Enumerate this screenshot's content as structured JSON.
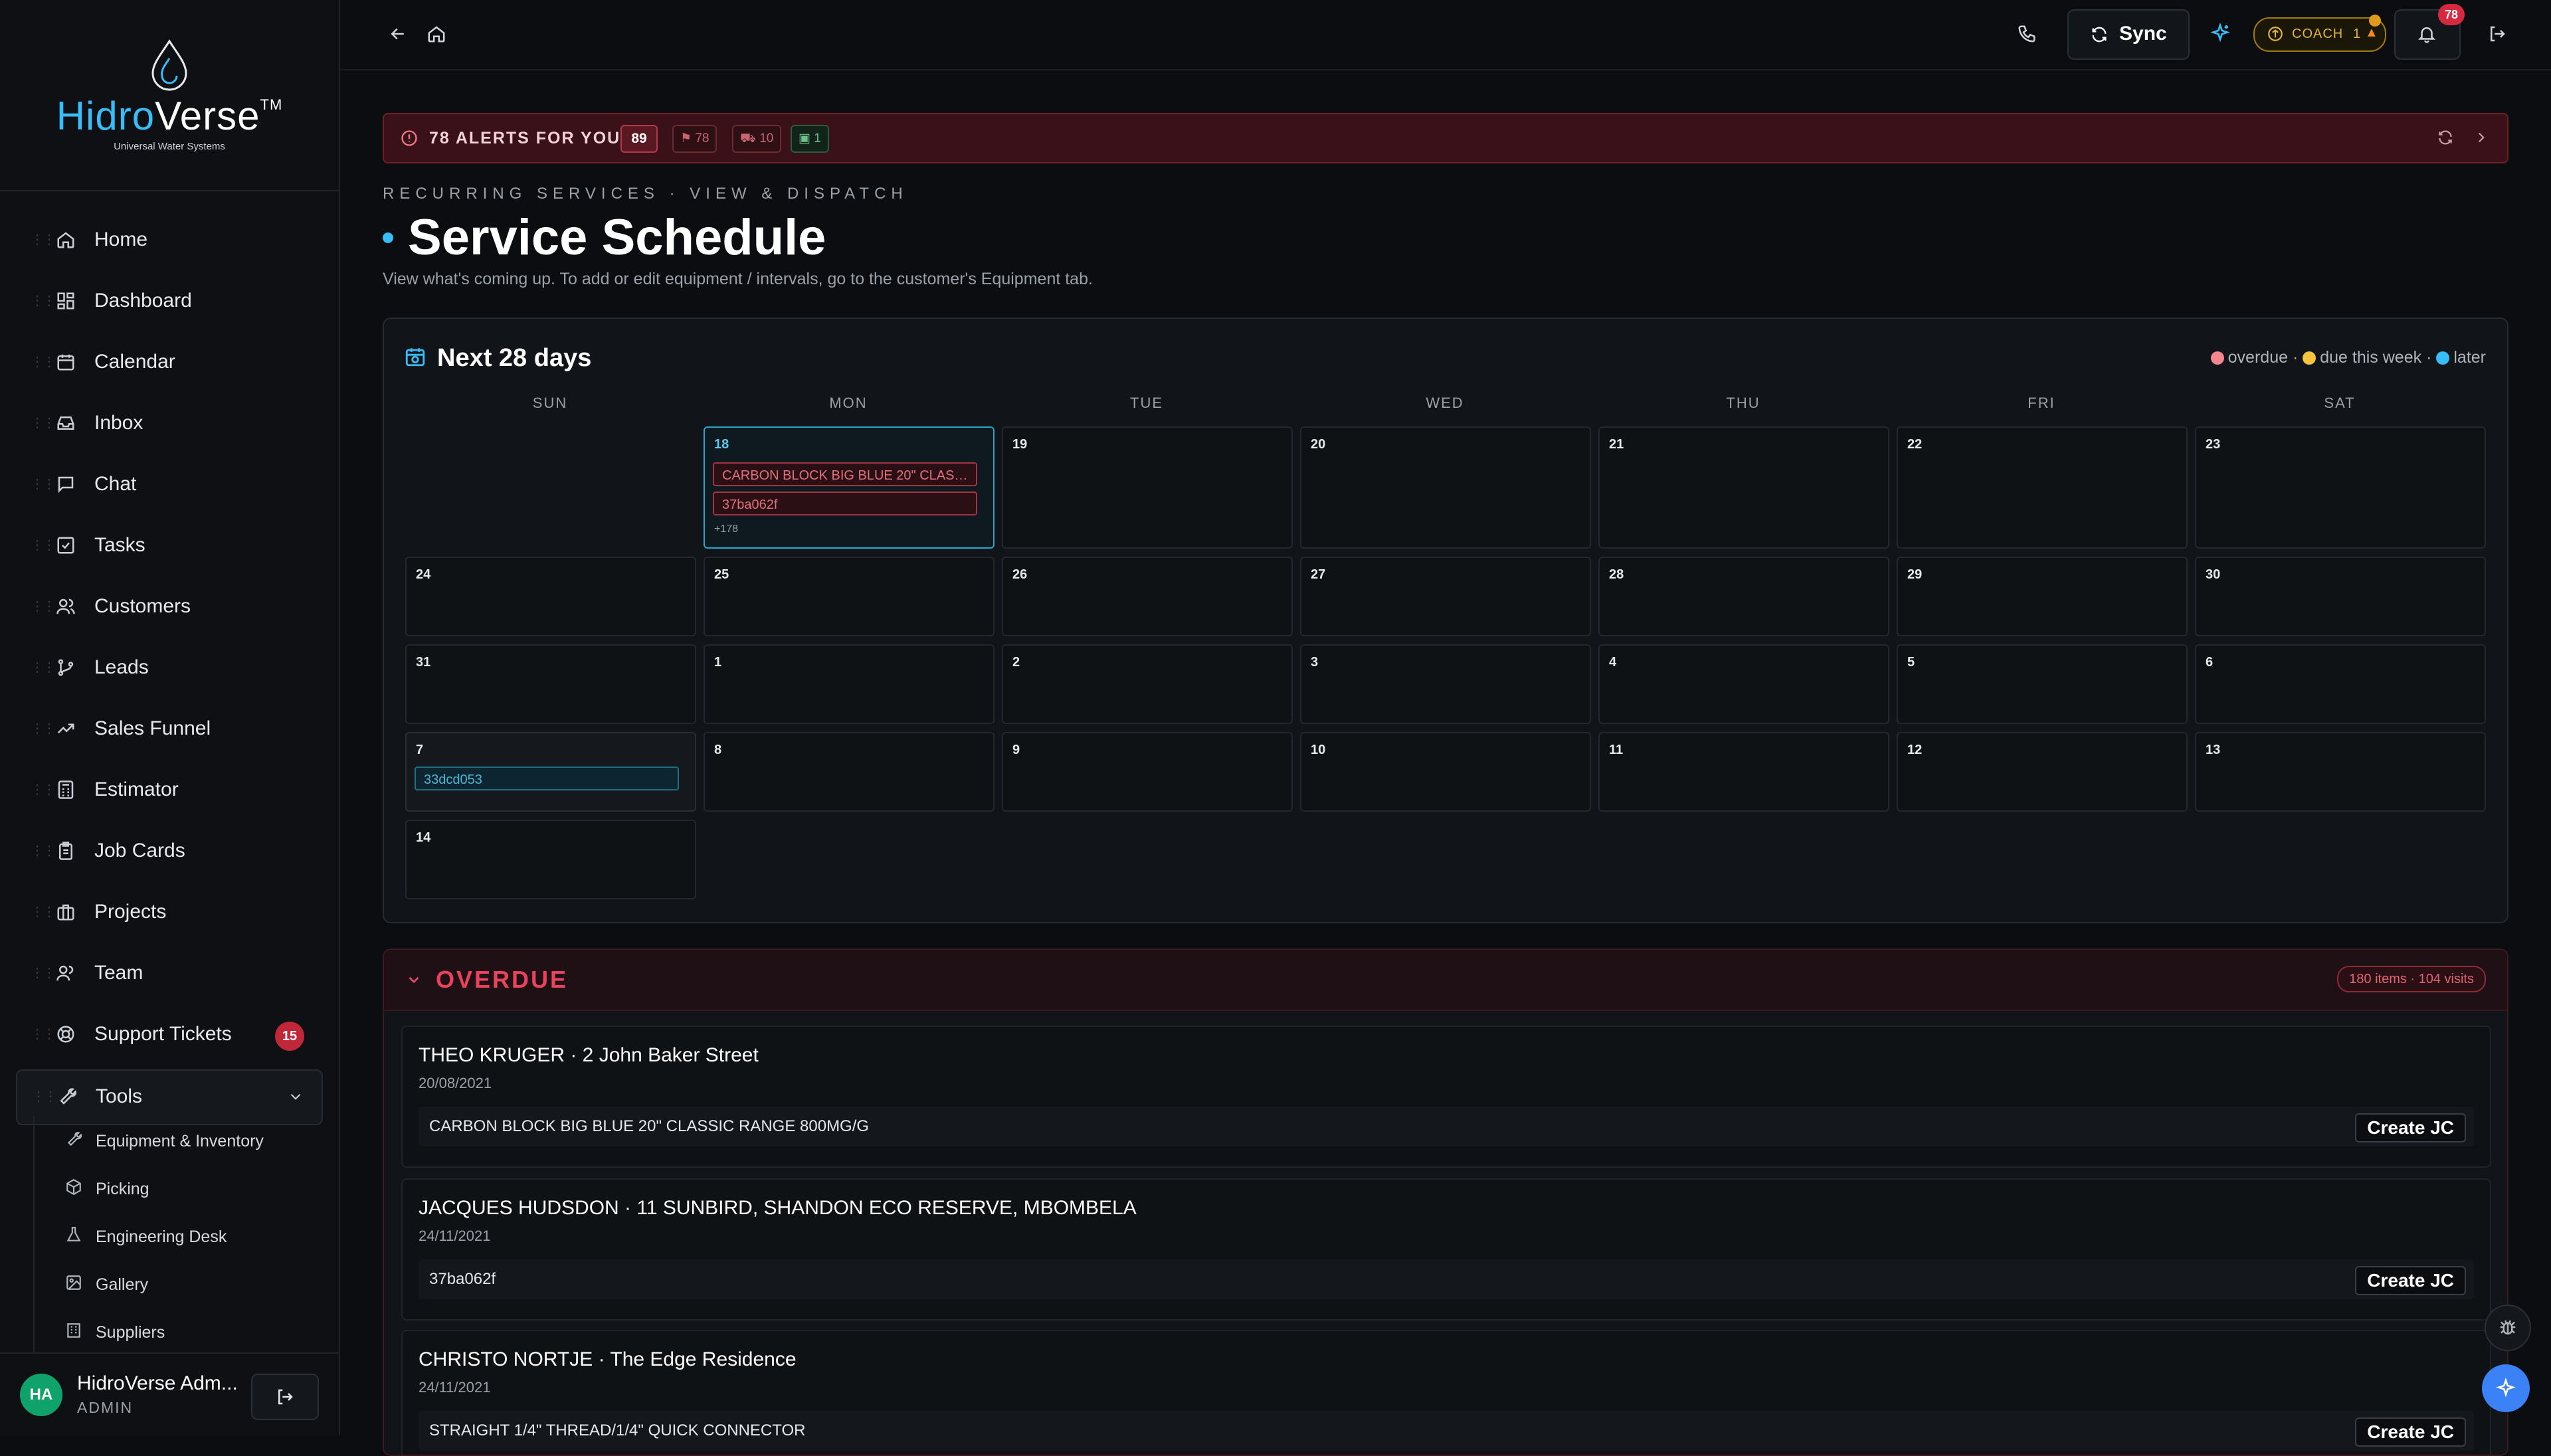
{
  "brand": {
    "name_part1": "Hidro",
    "name_part2": "Verse",
    "trademark": "TM",
    "tagline": "Universal Water Systems"
  },
  "sidebar": {
    "items": [
      {
        "label": "Home",
        "icon": "home-icon"
      },
      {
        "label": "Dashboard",
        "icon": "dashboard-icon"
      },
      {
        "label": "Calendar",
        "icon": "calendar-icon"
      },
      {
        "label": "Inbox",
        "icon": "inbox-icon"
      },
      {
        "label": "Chat",
        "icon": "chat-icon"
      },
      {
        "label": "Tasks",
        "icon": "tasks-icon"
      },
      {
        "label": "Customers",
        "icon": "customers-icon"
      },
      {
        "label": "Leads",
        "icon": "leads-icon"
      },
      {
        "label": "Sales Funnel",
        "icon": "trend-icon"
      },
      {
        "label": "Estimator",
        "icon": "calculator-icon"
      },
      {
        "label": "Job Cards",
        "icon": "clipboard-icon"
      },
      {
        "label": "Projects",
        "icon": "briefcase-icon"
      },
      {
        "label": "Team",
        "icon": "team-icon"
      },
      {
        "label": "Support Tickets",
        "icon": "lifebuoy-icon",
        "badge": "15"
      }
    ],
    "tools": {
      "label": "Tools",
      "icon": "wrench-icon"
    },
    "tools_sub": [
      {
        "label": "Equipment & Inventory",
        "icon": "wrench-icon"
      },
      {
        "label": "Picking",
        "icon": "package-icon"
      },
      {
        "label": "Engineering Desk",
        "icon": "flask-icon"
      },
      {
        "label": "Gallery",
        "icon": "image-icon"
      },
      {
        "label": "Suppliers",
        "icon": "building-icon"
      }
    ],
    "user": {
      "initials": "HA",
      "name": "HidroVerse Adm...",
      "role": "ADMIN"
    }
  },
  "topbar": {
    "sync_label": "Sync",
    "coach_label": "COACH",
    "coach_count": "1",
    "notification_count": "78"
  },
  "alerts": {
    "text": "78 ALERTS FOR YOU",
    "count": "89",
    "pills": {
      "flag": "78",
      "cart": "10",
      "box": "1"
    }
  },
  "page": {
    "kicker": "RECURRING SERVICES · VIEW & DISPATCH",
    "title": "Service Schedule",
    "subtitle": "View what's coming up. To add or edit equipment / intervals, go to the customer's Equipment tab."
  },
  "calendar": {
    "title": "Next 28 days",
    "legend": {
      "overdue": "overdue",
      "due_this_week": "due this week",
      "later": "later",
      "sep": "·"
    },
    "colors": {
      "overdue": "#f5868f",
      "due_this_week": "#f5c542",
      "later": "#38bdf8"
    },
    "weekdays": [
      "SUN",
      "MON",
      "TUE",
      "WED",
      "THU",
      "FRI",
      "SAT"
    ],
    "week1": [
      "18",
      "19",
      "20",
      "21",
      "22",
      "23"
    ],
    "week2": [
      "24",
      "25",
      "26",
      "27",
      "28",
      "29",
      "30"
    ],
    "week3": [
      "31",
      "1",
      "2",
      "3",
      "4",
      "5",
      "6"
    ],
    "week4": [
      "7",
      "8",
      "9",
      "10",
      "11",
      "12",
      "13"
    ],
    "week5": [
      "14"
    ],
    "today_events": [
      "CARBON BLOCK BIG BLUE 20\" CLASSIC RANGE 800MG/G",
      "37ba062f"
    ],
    "today_more": "+178",
    "day7_event": "33dcd053"
  },
  "overdue": {
    "title": "OVERDUE",
    "count": "180 items · 104 visits",
    "items": [
      {
        "name": "THEO KRUGER · 2 John Baker Street",
        "date": "20/08/2021",
        "line": "CARBON BLOCK BIG BLUE 20\" CLASSIC RANGE 800MG/G",
        "action": "Create JC"
      },
      {
        "name": "JACQUES HUDSDON · 11 SUNBIRD, SHANDON ECO RESERVE, MBOMBELA",
        "date": "24/11/2021",
        "line": "37ba062f",
        "action": "Create JC"
      },
      {
        "name": "CHRISTO NORTJE · The Edge Residence",
        "date": "24/11/2021",
        "line": "STRAIGHT 1/4\" THREAD/1/4\" QUICK CONNECTOR",
        "action": "Create JC"
      }
    ]
  }
}
